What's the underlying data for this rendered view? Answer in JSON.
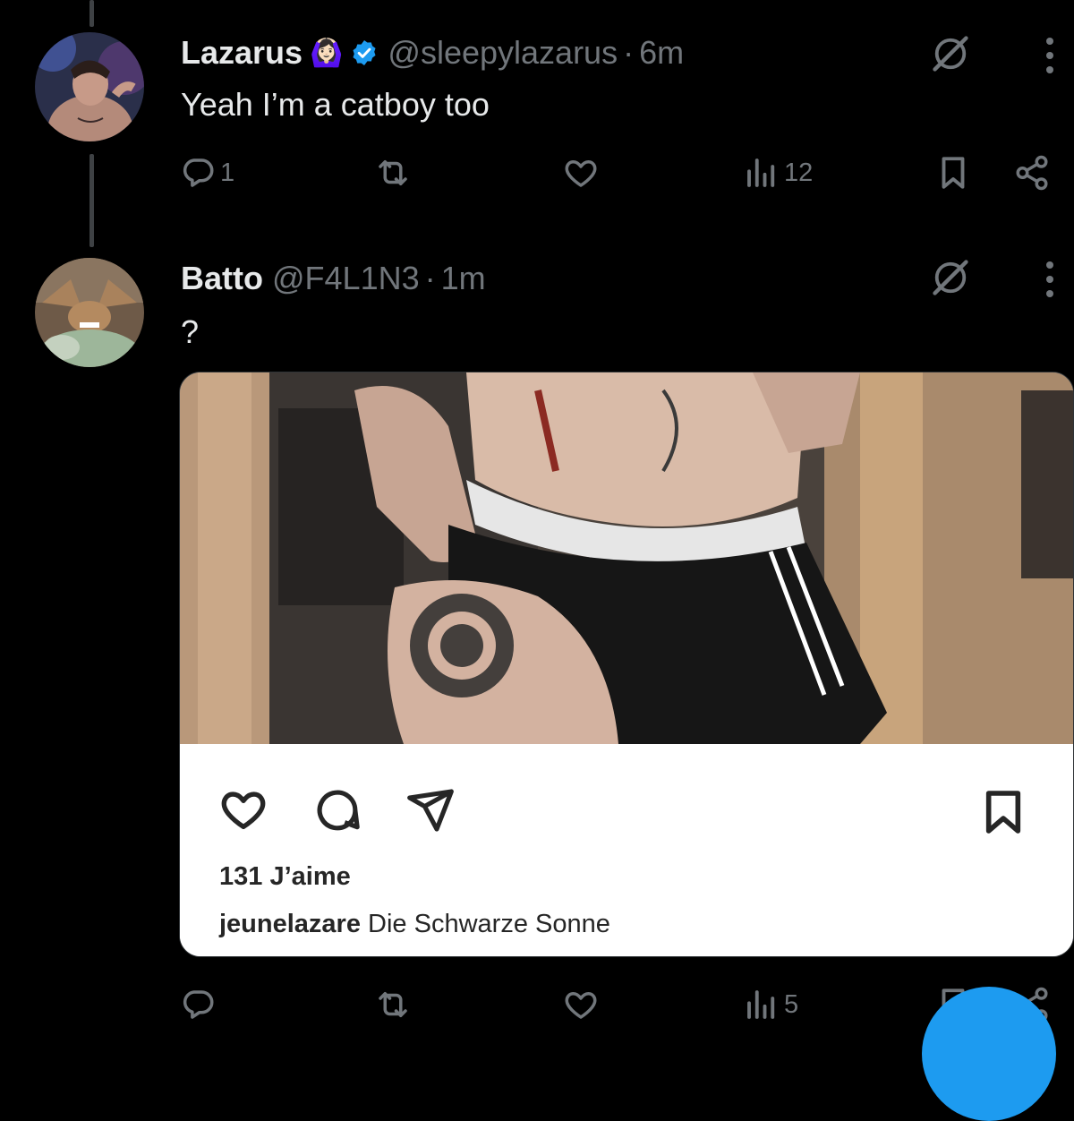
{
  "posts": [
    {
      "name": "Lazarus",
      "emoji_badge": "🙆🏻‍♀️",
      "verified": true,
      "handle": "@sleepylazarus",
      "separator": "·",
      "time": "6m",
      "text": "Yeah I’m a catboy too",
      "replies": "1",
      "reposts": "",
      "likes": "",
      "views": "12"
    },
    {
      "name": "Batto",
      "handle": "@F4L1N3",
      "separator": "·",
      "time": "1m",
      "text": "?",
      "replies": "",
      "reposts": "",
      "likes": "",
      "views": "5",
      "media": {
        "instagram_likes": "131 J’aime",
        "instagram_user": "jeunelazare",
        "instagram_caption": "Die Schwarze Sonne"
      }
    }
  ],
  "colors": {
    "background": "#000000",
    "text": "#e7e9ea",
    "secondary": "#71767b",
    "verified": "#1d9bf0",
    "accent": "#1d9bf0"
  },
  "icons": [
    "reply-icon",
    "repost-icon",
    "like-icon",
    "views-icon",
    "bookmark-icon",
    "share-icon",
    "grok-icon",
    "more-icon",
    "verified-badge-icon"
  ]
}
